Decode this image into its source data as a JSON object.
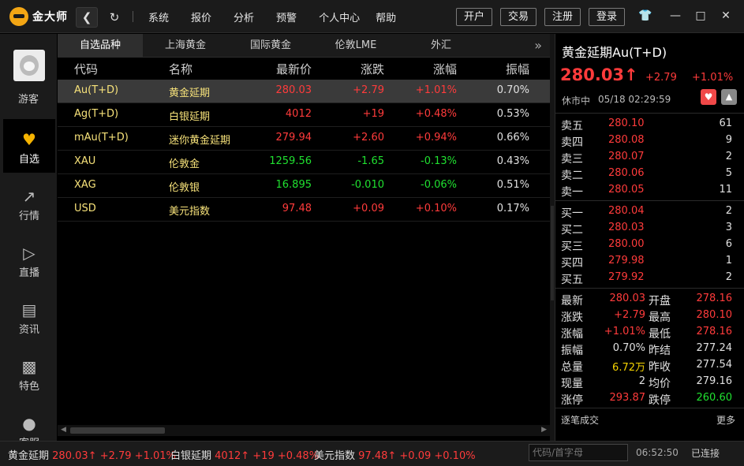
{
  "app": {
    "logo_text": "金大师"
  },
  "menu": [
    "系统",
    "报价",
    "分析",
    "预警",
    "个人中心",
    "帮助"
  ],
  "top_buttons": [
    "开户",
    "交易",
    "注册",
    "登录"
  ],
  "user": {
    "name": "游客"
  },
  "nav": [
    {
      "label": "自选",
      "icon": "heart-icon",
      "active": true
    },
    {
      "label": "行情",
      "icon": "chart-line-icon"
    },
    {
      "label": "直播",
      "icon": "play-icon"
    },
    {
      "label": "资讯",
      "icon": "news-icon"
    },
    {
      "label": "特色",
      "icon": "bar-chart-icon"
    },
    {
      "label": "客服",
      "icon": "chat-icon"
    }
  ],
  "tabs": [
    "自选品种",
    "上海黄金",
    "国际黄金",
    "伦敦LME",
    "外汇"
  ],
  "table": {
    "headers": [
      "代码",
      "名称",
      "最新价",
      "涨跌",
      "涨幅",
      "振幅"
    ],
    "rows": [
      {
        "code": "Au(T+D)",
        "name": "黄金延期",
        "price": "280.03",
        "chg": "+2.79",
        "pct": "+1.01%",
        "amp": "0.70%",
        "dir": "up"
      },
      {
        "code": "Ag(T+D)",
        "name": "白银延期",
        "price": "4012",
        "chg": "+19",
        "pct": "+0.48%",
        "amp": "0.53%",
        "dir": "up"
      },
      {
        "code": "mAu(T+D)",
        "name": "迷你黄金延期",
        "price": "279.94",
        "chg": "+2.60",
        "pct": "+0.94%",
        "amp": "0.66%",
        "dir": "up"
      },
      {
        "code": "XAU",
        "name": "伦敦金",
        "price": "1259.56",
        "chg": "-1.65",
        "pct": "-0.13%",
        "amp": "0.43%",
        "dir": "dn"
      },
      {
        "code": "XAG",
        "name": "伦敦银",
        "price": "16.895",
        "chg": "-0.010",
        "pct": "-0.06%",
        "amp": "0.51%",
        "dir": "dn"
      },
      {
        "code": "USD",
        "name": "美元指数",
        "price": "97.48",
        "chg": "+0.09",
        "pct": "+0.10%",
        "amp": "0.17%",
        "dir": "up"
      }
    ]
  },
  "detail": {
    "title": "黄金延期Au(T+D)",
    "price": "280.03↑",
    "chg": "+2.79",
    "pct": "+1.01%",
    "status": "休市中",
    "time": "05/18 02:29:59",
    "asks": [
      {
        "label": "卖五",
        "price": "280.10",
        "vol": "61"
      },
      {
        "label": "卖四",
        "price": "280.08",
        "vol": "9"
      },
      {
        "label": "卖三",
        "price": "280.07",
        "vol": "2"
      },
      {
        "label": "卖二",
        "price": "280.06",
        "vol": "5"
      },
      {
        "label": "卖一",
        "price": "280.05",
        "vol": "11"
      }
    ],
    "bids": [
      {
        "label": "买一",
        "price": "280.04",
        "vol": "2"
      },
      {
        "label": "买二",
        "price": "280.03",
        "vol": "3"
      },
      {
        "label": "买三",
        "price": "280.00",
        "vol": "6"
      },
      {
        "label": "买四",
        "price": "279.98",
        "vol": "1"
      },
      {
        "label": "买五",
        "price": "279.92",
        "vol": "2"
      }
    ],
    "stats": [
      {
        "l1": "最新",
        "v1": "280.03",
        "c1": "up",
        "l2": "开盘",
        "v2": "278.16",
        "c2": "up"
      },
      {
        "l1": "涨跌",
        "v1": "+2.79",
        "c1": "up",
        "l2": "最高",
        "v2": "280.10",
        "c2": "up"
      },
      {
        "l1": "涨幅",
        "v1": "+1.01%",
        "c1": "up",
        "l2": "最低",
        "v2": "278.16",
        "c2": "up"
      },
      {
        "l1": "振幅",
        "v1": "0.70%",
        "c1": "wh",
        "l2": "昨结",
        "v2": "277.24",
        "c2": "wh"
      },
      {
        "l1": "总量",
        "v1": "6.72万",
        "c1": "yl",
        "l2": "昨收",
        "v2": "277.54",
        "c2": "wh"
      },
      {
        "l1": "现量",
        "v1": "2",
        "c1": "wh",
        "l2": "均价",
        "v2": "279.16",
        "c2": "wh"
      },
      {
        "l1": "涨停",
        "v1": "293.87",
        "c1": "up",
        "l2": "跌停",
        "v2": "260.60",
        "c2": "dn"
      }
    ],
    "trades_label": "逐笔成交",
    "more_label": "更多"
  },
  "ticker": [
    {
      "name": "黄金延期",
      "price": "280.03↑",
      "chg": "+2.79",
      "pct": "+1.01%"
    },
    {
      "name": "白银延期",
      "price": "4012↑",
      "chg": "+19",
      "pct": "+0.48%"
    },
    {
      "name": "美元指数",
      "price": "97.48↑",
      "chg": "+0.09",
      "pct": "+0.10%"
    }
  ],
  "search": {
    "placeholder": "代码/首字母"
  },
  "clock": "06:52:50",
  "connection": "已连接",
  "colors": {
    "up": "#ff3b3b",
    "down": "#20e030",
    "accent": "#f5b301"
  }
}
